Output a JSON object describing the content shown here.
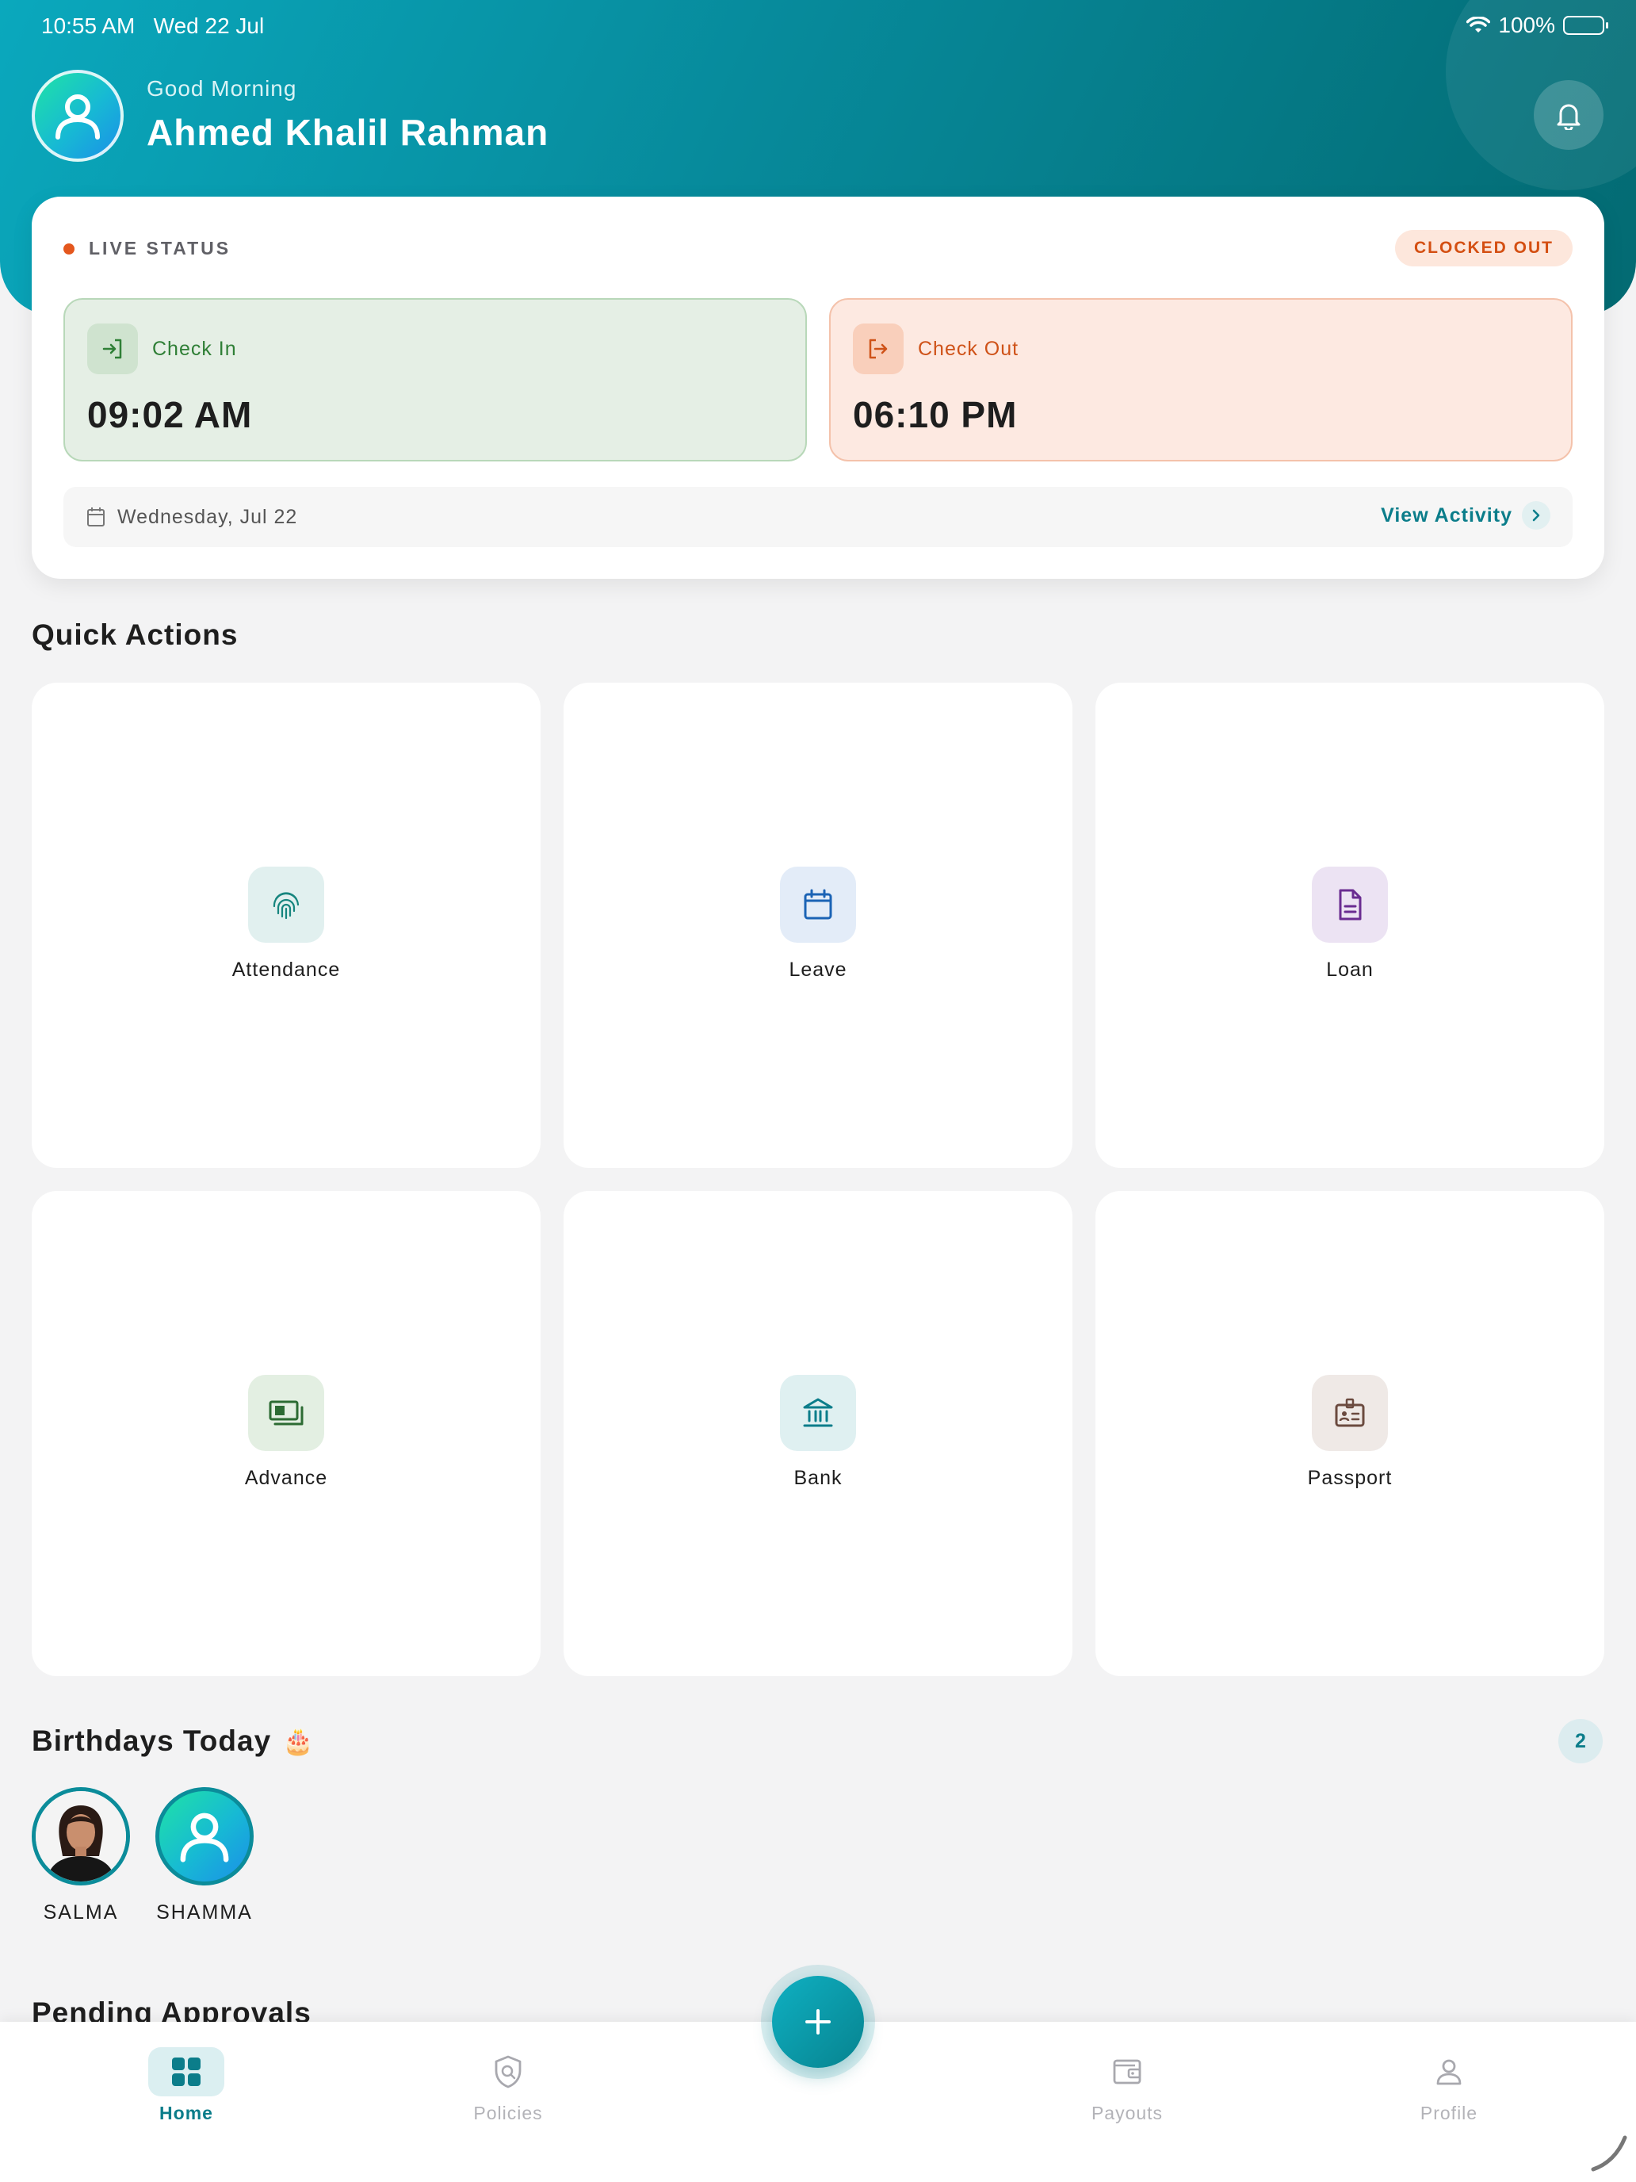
{
  "status_bar": {
    "time": "10:55 AM",
    "date": "Wed 22 Jul",
    "battery": "100%"
  },
  "header": {
    "greeting": "Good Morning",
    "user_name": "Ahmed Khalil Rahman"
  },
  "live_status": {
    "label": "LIVE STATUS",
    "badge": "CLOCKED OUT",
    "check_in": {
      "label": "Check In",
      "time": "09:02 AM"
    },
    "check_out": {
      "label": "Check Out",
      "time": "06:10 PM"
    },
    "date": "Wednesday, Jul 22",
    "view_activity": "View Activity"
  },
  "quick_actions": {
    "title": "Quick Actions",
    "items": [
      {
        "label": "Attendance",
        "icon": "fingerprint-icon"
      },
      {
        "label": "Leave",
        "icon": "calendar-icon"
      },
      {
        "label": "Loan",
        "icon": "document-icon"
      },
      {
        "label": "Advance",
        "icon": "cash-icon"
      },
      {
        "label": "Bank",
        "icon": "bank-icon"
      },
      {
        "label": "Passport",
        "icon": "id-badge-icon"
      }
    ]
  },
  "birthdays": {
    "title": "Birthdays Today",
    "emoji": "🎂",
    "count": "2",
    "people": [
      {
        "name": "SALMA"
      },
      {
        "name": "SHAMMA"
      }
    ]
  },
  "pending_approvals": {
    "title": "Pending Approvals"
  },
  "bottom_nav": {
    "items": [
      {
        "label": "Home",
        "active": true
      },
      {
        "label": "Policies",
        "active": false
      },
      {
        "label": "Payouts",
        "active": false
      },
      {
        "label": "Profile",
        "active": false
      }
    ]
  },
  "colors": {
    "brand": "#0b8c9a",
    "check_in": "#2f7f36",
    "check_out": "#cf5218",
    "clocked_out_badge": "#d44f12"
  }
}
